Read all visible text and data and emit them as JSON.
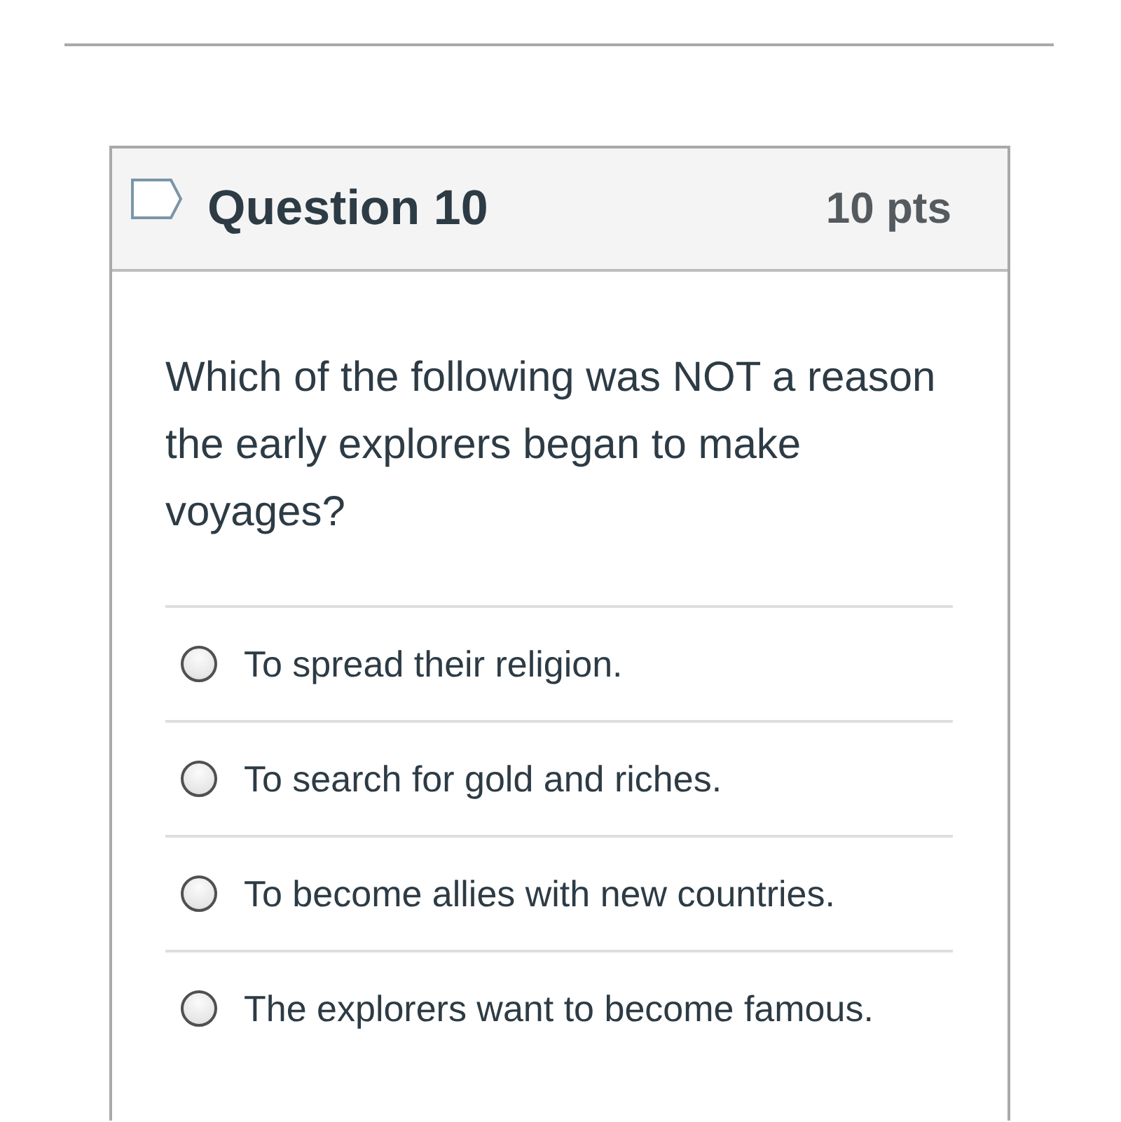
{
  "question": {
    "title": "Question 10",
    "points": "10 pts",
    "flagged": false,
    "text": "Which of the following was NOT a reason the early explorers began to make voyages?"
  },
  "answers": [
    {
      "label": "To spread their religion.",
      "selected": false
    },
    {
      "label": "To search for gold and riches.",
      "selected": false
    },
    {
      "label": "To become allies with new countries.",
      "selected": false
    },
    {
      "label": "The explorers want to become famous.",
      "selected": false
    }
  ]
}
